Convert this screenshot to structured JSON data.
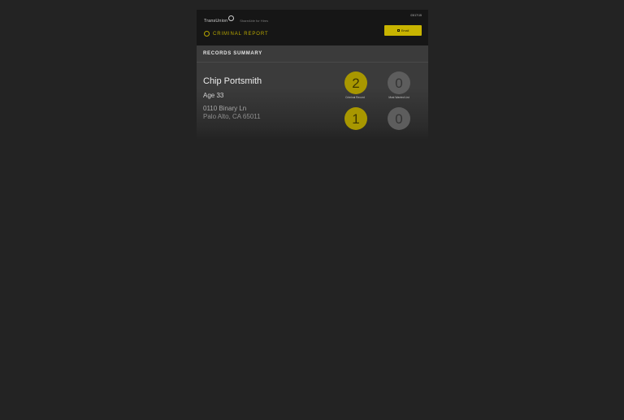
{
  "header": {
    "logo": "TransUnion",
    "tagline": "ShareAble for Hires",
    "date": "03/17/15",
    "report_title": "CRIMINAL REPORT",
    "email_label": "Email",
    "icons": {
      "logo": "transunion-logo",
      "report": "criminal-report-icon",
      "email": "mail-icon"
    }
  },
  "summary": {
    "heading": "RECORDS SUMMARY",
    "person": {
      "name": "Chip Portsmith",
      "age": "Age 33",
      "address_line1": "0110 Binary Ln",
      "address_line2": "Palo Alto, CA  65011"
    },
    "stats": [
      {
        "value": "2",
        "label": "Criminal Record",
        "color": "#a89700"
      },
      {
        "value": "0",
        "label": "Most Wanted List",
        "color": "#5d5d5d"
      },
      {
        "value": "1",
        "label": "",
        "color": "#a89700"
      },
      {
        "value": "0",
        "label": "",
        "color": "#5d5d5d"
      }
    ]
  },
  "colors": {
    "accent": "#c8b400",
    "background": "#232323"
  }
}
